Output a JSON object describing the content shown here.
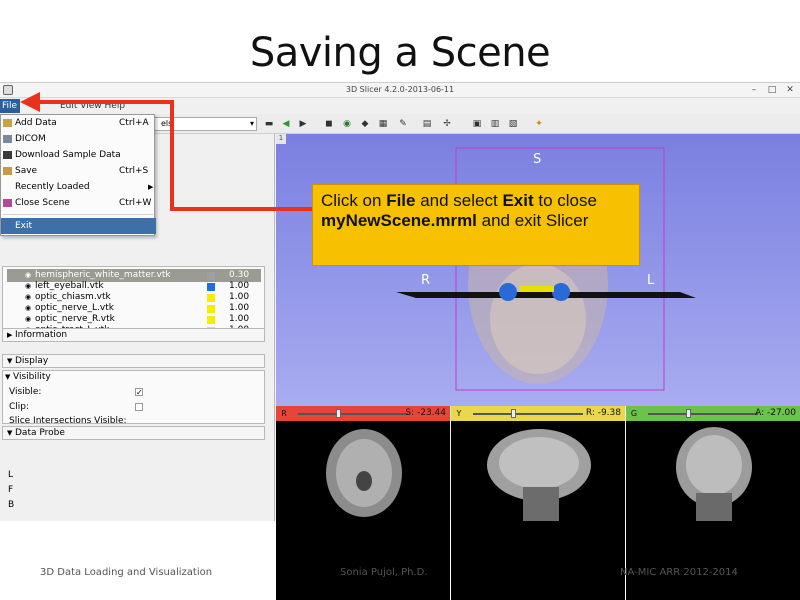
{
  "slide": {
    "title": "Saving a Scene",
    "footer_left": "3D Data Loading and Visualization",
    "footer_center": "Sonia Pujol, Ph.D.",
    "footer_right": "NA-MIC ARR 2012-2014"
  },
  "window": {
    "title": "3D Slicer 4.2.0-2013-06-11",
    "controls": [
      "–",
      "□",
      "✕"
    ]
  },
  "menubar": {
    "file_label": "File",
    "rest_label": "Edit View Help"
  },
  "toolbar": {
    "module_select_value": "els"
  },
  "file_menu": {
    "items": [
      {
        "label": "Add Data",
        "shortcut": "Ctrl+A"
      },
      {
        "label": "DICOM",
        "shortcut": ""
      },
      {
        "label": "Download Sample Data",
        "shortcut": ""
      },
      {
        "label": "Save",
        "shortcut": "Ctrl+S"
      },
      {
        "label": "Recently Loaded",
        "shortcut": "",
        "submenu": "▶"
      },
      {
        "label": "Close Scene",
        "shortcut": "Ctrl+W"
      },
      {
        "label": "Exit",
        "shortcut": ""
      }
    ]
  },
  "models": {
    "rows": [
      {
        "name": "hemispheric_white_matter.vtk",
        "opacity": "0.30",
        "color": "#a0a0a0",
        "selected": true
      },
      {
        "name": "left_eyeball.vtk",
        "opacity": "1.00",
        "color": "#1f6fe0"
      },
      {
        "name": "optic_chiasm.vtk",
        "opacity": "1.00",
        "color": "#f5ee00"
      },
      {
        "name": "optic_nerve_L.vtk",
        "opacity": "1.00",
        "color": "#f5ee00"
      },
      {
        "name": "optic_nerve_R.vtk",
        "opacity": "1.00",
        "color": "#f5ee00"
      },
      {
        "name": "optic_tract_L.vtk",
        "opacity": "1.00",
        "color": "#f5ee00"
      }
    ]
  },
  "sections": {
    "information": "Information",
    "display": "Display",
    "visibility": "Visibility",
    "visible_label": "Visible:",
    "clip_label": "Clip:",
    "slice_vis_label": "Slice Intersections Visible:",
    "data_probe": "Data Probe",
    "probe_lines": [
      "L",
      "F",
      "B"
    ]
  },
  "view3d": {
    "tab": "1",
    "orient_s": "S",
    "orient_r": "R",
    "orient_l": "L"
  },
  "callout": {
    "t1": "Click on ",
    "b1": "File",
    "t2": " and select ",
    "b2": "Exit",
    "t3": " to close ",
    "b3": "myNewScene.mrml",
    "t4": " and exit Slicer"
  },
  "slices": [
    {
      "letter": "R",
      "coord": "S: -23.44",
      "bar_color": "#e8453a"
    },
    {
      "letter": "Y",
      "coord": "R: -9.38",
      "bar_color": "#e8d84a"
    },
    {
      "letter": "G",
      "coord": "A: -27.00",
      "bar_color": "#6cc24a"
    }
  ]
}
